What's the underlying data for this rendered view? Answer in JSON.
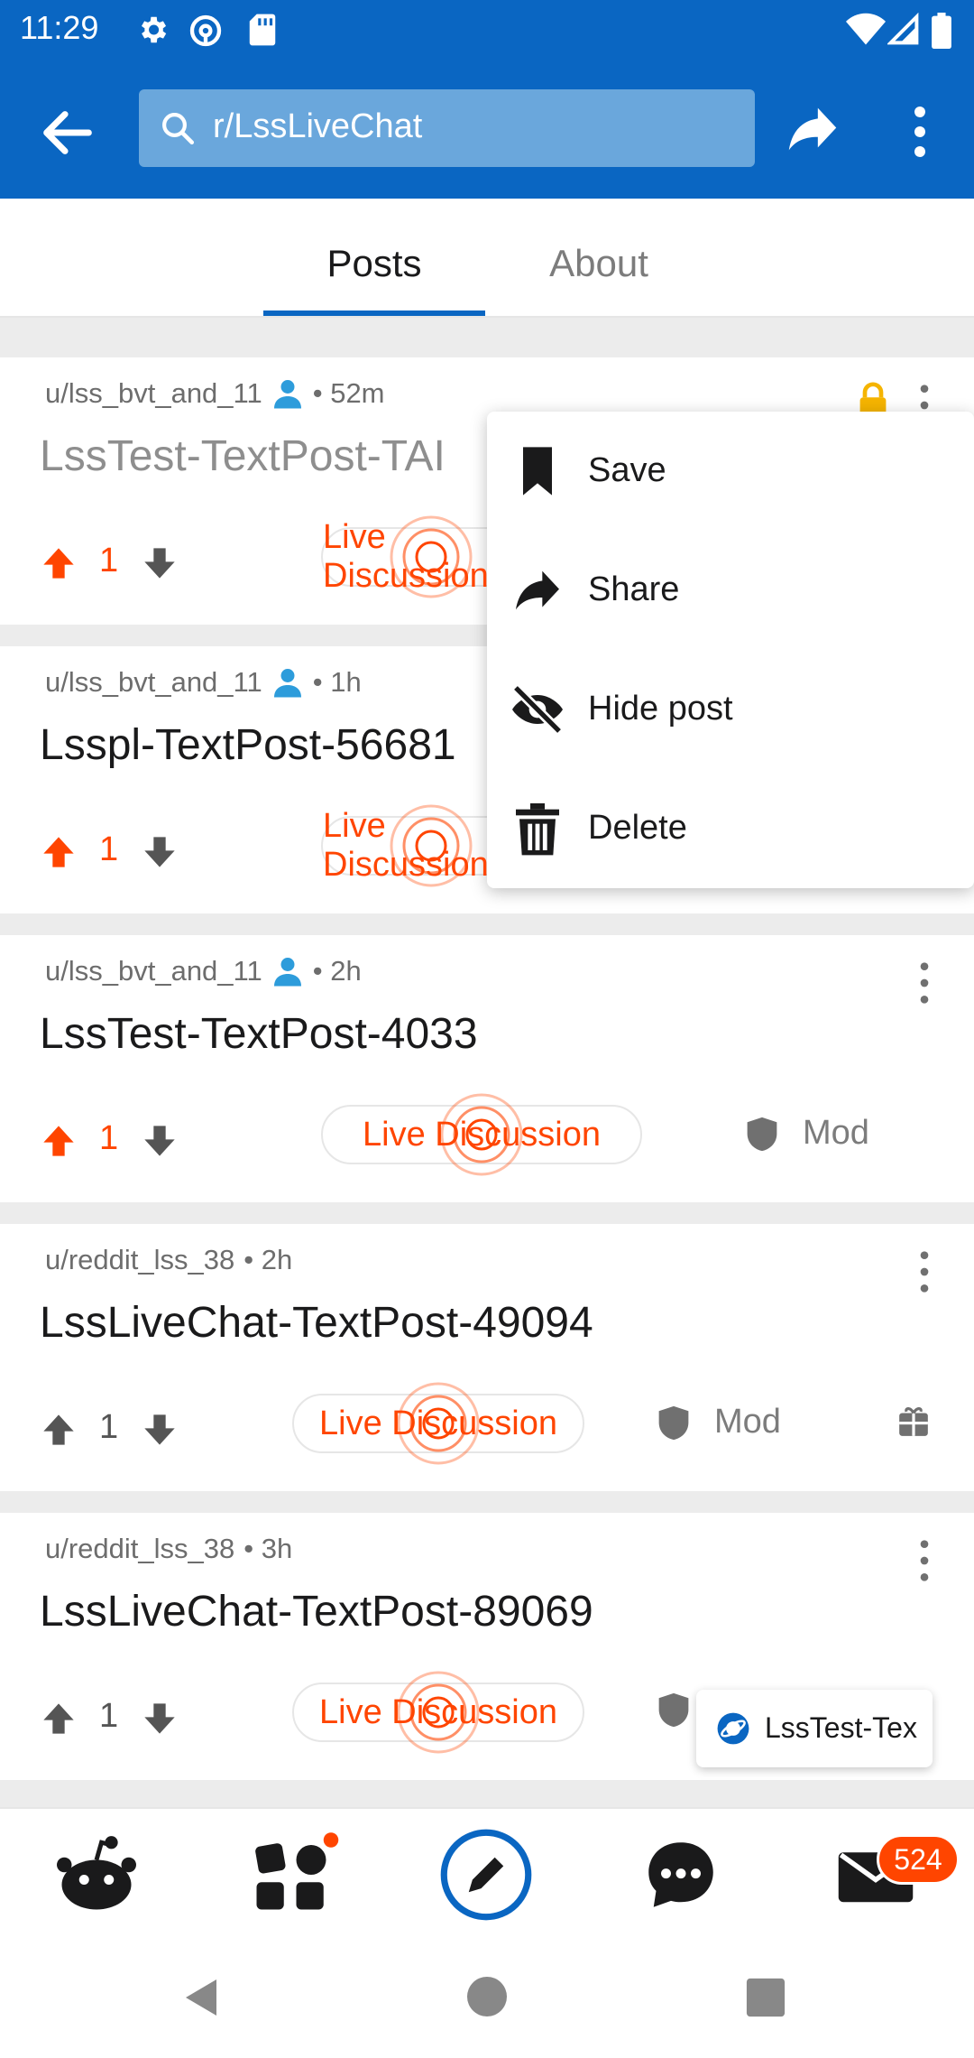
{
  "status_bar": {
    "time": "11:29"
  },
  "search": {
    "query": "r/LssLiveChat"
  },
  "tabs": [
    {
      "label": "Posts"
    },
    {
      "label": "About"
    }
  ],
  "posts": [
    {
      "author": "u/lss_bvt_and_11",
      "age": "• 52m",
      "title": "LssTest-TextPost-TAI",
      "votes": "1",
      "live_label": "Live Discussion",
      "mod_label": ""
    },
    {
      "author": "u/lss_bvt_and_11",
      "age": "• 1h",
      "title": "Lsspl-TextPost-56681",
      "votes": "1",
      "live_label": "Live Discussion",
      "mod_label": ""
    },
    {
      "author": "u/lss_bvt_and_11",
      "age": "• 2h",
      "title": "LssTest-TextPost-4033",
      "votes": "1",
      "live_label": "Live Discussion",
      "mod_label": "Mod"
    },
    {
      "author": "u/reddit_lss_38",
      "age": "• 2h",
      "title": "LssLiveChat-TextPost-49094",
      "votes": "1",
      "live_label": "Live Discussion",
      "mod_label": "Mod"
    },
    {
      "author": "u/reddit_lss_38",
      "age": "• 3h",
      "title": "LssLiveChat-TextPost-89069",
      "votes": "1",
      "live_label": "Live Discussion",
      "mod_label": ""
    }
  ],
  "menu": {
    "items": [
      {
        "label": "Save"
      },
      {
        "label": "Share"
      },
      {
        "label": "Hide post"
      },
      {
        "label": "Delete"
      }
    ]
  },
  "chip": {
    "label": "LssTest-Tex"
  },
  "bottom_nav": {
    "inbox_badge": "524"
  },
  "colors": {
    "brand_blue": "#0a66c2",
    "accent_orange": "#ff4500",
    "lock_yellow": "#f5b400"
  }
}
